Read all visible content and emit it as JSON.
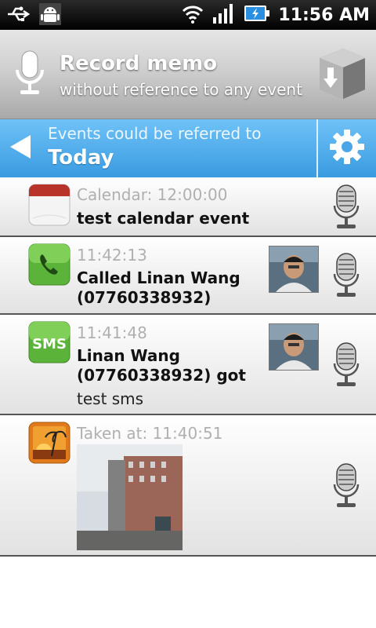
{
  "status_bar": {
    "time": "11:56 AM",
    "icons": [
      "usb-icon",
      "android-debug-icon",
      "wifi-icon",
      "signal-icon",
      "battery-charging-icon"
    ]
  },
  "record": {
    "title": "Record memo",
    "subtitle": "without reference to any event",
    "icons": [
      "microphone-icon",
      "save-box-icon"
    ]
  },
  "events_bar": {
    "caption": "Events could be referred to",
    "period": "Today",
    "icons": [
      "back-arrow-icon",
      "gear-icon"
    ]
  },
  "events": [
    {
      "type": "calendar",
      "icon": "calendar-icon",
      "time": "Calendar: 12:00:00",
      "text": "test calendar event"
    },
    {
      "type": "call",
      "icon": "phone-icon",
      "time": "11:42:13",
      "text_line1": "Called Linan Wang",
      "text_line2": "(07760338932)",
      "has_photo": true
    },
    {
      "type": "sms",
      "icon": "sms-icon",
      "icon_label": "SMS",
      "time": "11:41:48",
      "text_line1": "Linan Wang",
      "text_line2": "(07760338932) got",
      "message": "test sms",
      "has_photo": true
    },
    {
      "type": "photo",
      "icon": "gallery-icon",
      "time": "Taken at: 11:40:51"
    }
  ],
  "colors": {
    "accent_blue": "#3a9be0",
    "time_gray": "#b0b0b0"
  }
}
